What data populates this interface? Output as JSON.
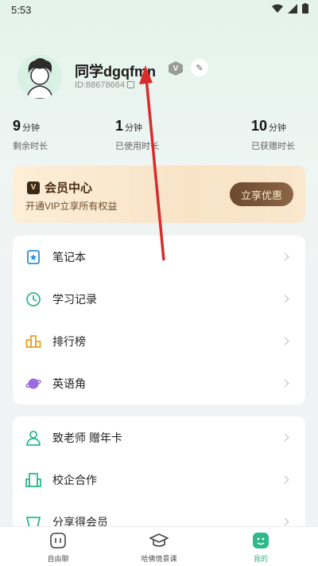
{
  "status": {
    "time": "5:53"
  },
  "profile": {
    "name": "同学dgqfmn",
    "vip_badge": "V",
    "id": "ID:88678664"
  },
  "stats": [
    {
      "value": "9",
      "unit": "分钟",
      "label": "剩余时长"
    },
    {
      "value": "1",
      "unit": "分钟",
      "label": "已使用时长"
    },
    {
      "value": "10",
      "unit": "分钟",
      "label": "已获赠时长"
    }
  ],
  "vip": {
    "logo": "V",
    "title": "会员中心",
    "subtitle": "开通VIP立享所有权益",
    "button": "立享优惠"
  },
  "menu1": [
    {
      "label": "笔记本",
      "icon": "notebook-icon"
    },
    {
      "label": "学习记录",
      "icon": "clock-icon"
    },
    {
      "label": "排行榜",
      "icon": "podium-icon"
    },
    {
      "label": "英语角",
      "icon": "planet-icon"
    }
  ],
  "menu2": [
    {
      "label": "致老师 赠年卡",
      "icon": "teacher-icon"
    },
    {
      "label": "校企合作",
      "icon": "building-icon"
    },
    {
      "label": "分享得会员",
      "icon": "share-gift-icon"
    }
  ],
  "tabs": [
    {
      "label": "自由聊",
      "icon": "chat-icon"
    },
    {
      "label": "哈佛情景课",
      "icon": "graduation-cap-icon"
    },
    {
      "label": "我的",
      "icon": "profile-icon",
      "active": true
    }
  ],
  "colors": {
    "accent": "#2fb98a",
    "annotation_arrow": "#d92b2b"
  }
}
